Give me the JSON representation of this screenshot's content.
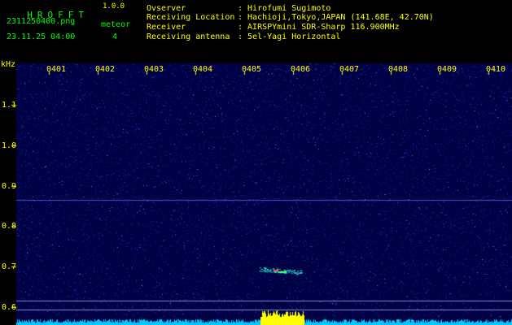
{
  "header": {
    "logo": "HROFFT",
    "version": "1.0.0",
    "filename": "2311250400.png",
    "datetime": "23.11.25 04:00",
    "meteor_label": "meteor",
    "meteor_count": "4",
    "info": [
      {
        "label": "Ovserver",
        "value": ": Hirofumi Sugimoto"
      },
      {
        "label": "Receiving Location",
        "value": ": Hachioji,Tokyo,JAPAN (141.68E, 42.70N)"
      },
      {
        "label": "Receiver",
        "value": ": AIRSPYmini SDR-Sharp 116.900MHz"
      },
      {
        "label": "Receiving antenna",
        "value": ": 5el-Yagi Horizontal"
      }
    ]
  },
  "spectrogram": {
    "unit_label": "kHz",
    "time_ticks": [
      "0401",
      "0402",
      "0403",
      "0404",
      "0405",
      "0406",
      "0407",
      "0408",
      "0409",
      "0410"
    ],
    "freq_ticks": [
      "1.1",
      "1.0",
      "0.9",
      "0.8",
      "0.7",
      "0.6"
    ],
    "colors": {
      "background": "#000044",
      "tick_text": "#ffff00",
      "baseline": "#00c8ff",
      "echo": "#ffff00"
    }
  }
}
